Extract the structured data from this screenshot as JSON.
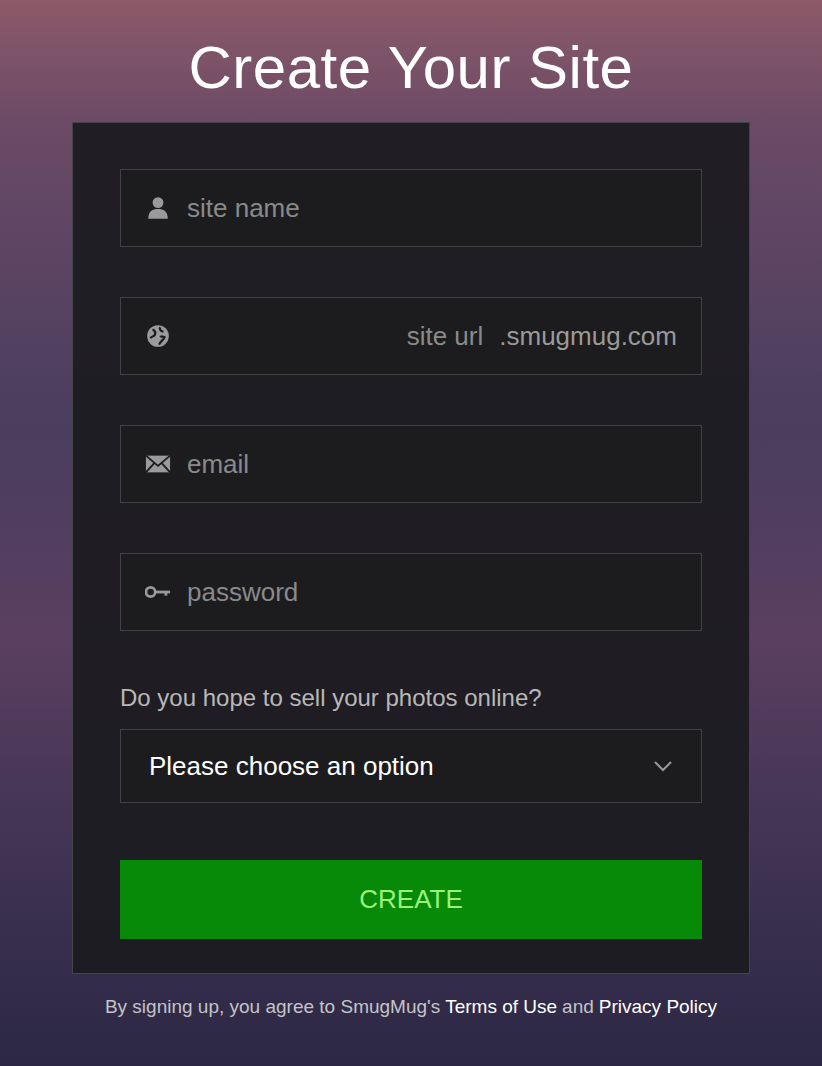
{
  "title": "Create Your Site",
  "fields": [
    {
      "kind": "name",
      "placeholder": "site name",
      "suffix": ""
    },
    {
      "kind": "url",
      "placeholder": "site url",
      "suffix": ".smugmug.com"
    },
    {
      "kind": "email",
      "placeholder": "email",
      "suffix": ""
    },
    {
      "kind": "password",
      "placeholder": "password",
      "suffix": ""
    }
  ],
  "question": "Do you hope to sell your photos online?",
  "select": {
    "placeholder": "Please choose an option"
  },
  "button": "CREATE",
  "footer": [
    {
      "text": "By signing up, you agree to SmugMug's",
      "link": false
    },
    {
      "text": "Terms of Use",
      "link": true
    },
    {
      "text": "and",
      "link": false
    },
    {
      "text": "Privacy Policy",
      "link": true
    }
  ]
}
